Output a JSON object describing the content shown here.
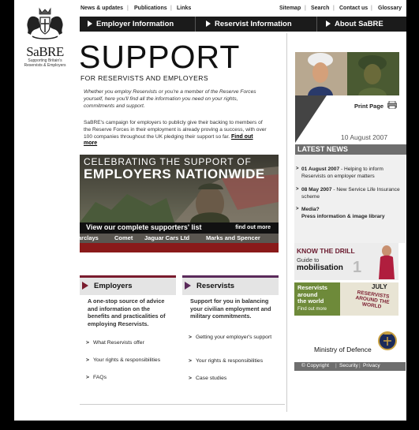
{
  "logo": {
    "brand": "SaBRE",
    "tagline1": "Supporting Britain's",
    "tagline2": "Reservists & Employers"
  },
  "topnav": {
    "news": "News & updates",
    "publications": "Publications",
    "links": "Links",
    "sitemap": "Sitemap",
    "search": "Search",
    "contact": "Contact us",
    "glossary": "Glossary"
  },
  "mainnav": {
    "employer": "Employer Information",
    "reservist": "Reservist Information",
    "about": "About SaBRE"
  },
  "hero": {
    "title": "SUPPORT",
    "subtitle": "FOR RESERVISTS AND EMPLOYERS"
  },
  "intro": {
    "p1": "Whether you employ Reservists or you're a member of the Reserve Forces yourself, here you'll find all the information you need on your rights, commitments and support.",
    "p2": "SaBRE's campaign for employers to publicly give their backing to members of the Reserve Forces in their employment is already proving a success, with over 100 companies throughout the UK pledging their support so far.",
    "find_more": "Find out more"
  },
  "banner": {
    "line1": "CELEBRATING THE SUPPORT OF",
    "line2": "EMPLOYERS NATIONWIDE",
    "view_list": "View our complete supporters' list",
    "find_out": "find out more",
    "supporters": [
      "arclays",
      "Comet",
      "Jaguar Cars Ltd",
      "Marks and Spencer"
    ]
  },
  "employers_box": {
    "title": "Employers",
    "desc": "A one-stop source of advice and information on the benefits and practicalities of employing Reservists.",
    "links": [
      "What Reservists offer",
      "Your rights & responsibilities",
      "FAQs"
    ]
  },
  "reservists_box": {
    "title": "Reservists",
    "desc": "Support for you in balancing your civilian employment and military commitments.",
    "links": [
      "Getting your employer's support",
      "Your rights & responsibilities",
      "Case studies"
    ]
  },
  "right": {
    "print": "Print Page",
    "date": "10 August 2007",
    "news_header": "LATEST NEWS",
    "news": [
      {
        "date": "01 August 2007",
        "text": " - Helping to inform Reservists on employer matters"
      },
      {
        "date": "08 May 2007",
        "text": " - New Service Life Insurance scheme"
      },
      {
        "date": "Media?",
        "text": "Press information & image library"
      }
    ],
    "know_drill": "KNOW THE DRILL",
    "guide_to": "Guide to",
    "mobilisation": "mobilisation",
    "drill_number": "1",
    "world_line1": "Reservists",
    "world_line2": "around",
    "world_line3": "the world",
    "world_find": "Find out more",
    "world_july": "JULY",
    "world_badge": "RESERVISTS AROUND THE WORLD",
    "mod": "Ministry of Defence",
    "footer": {
      "copyright": "© Copyright",
      "security": "Security",
      "privacy": "Privacy"
    }
  },
  "colors": {
    "accent_purple": "#5a2a5a",
    "accent_red": "#7a1c2e",
    "nav_bg": "#1b1b1b",
    "grey_bar": "#6e6e6e"
  }
}
